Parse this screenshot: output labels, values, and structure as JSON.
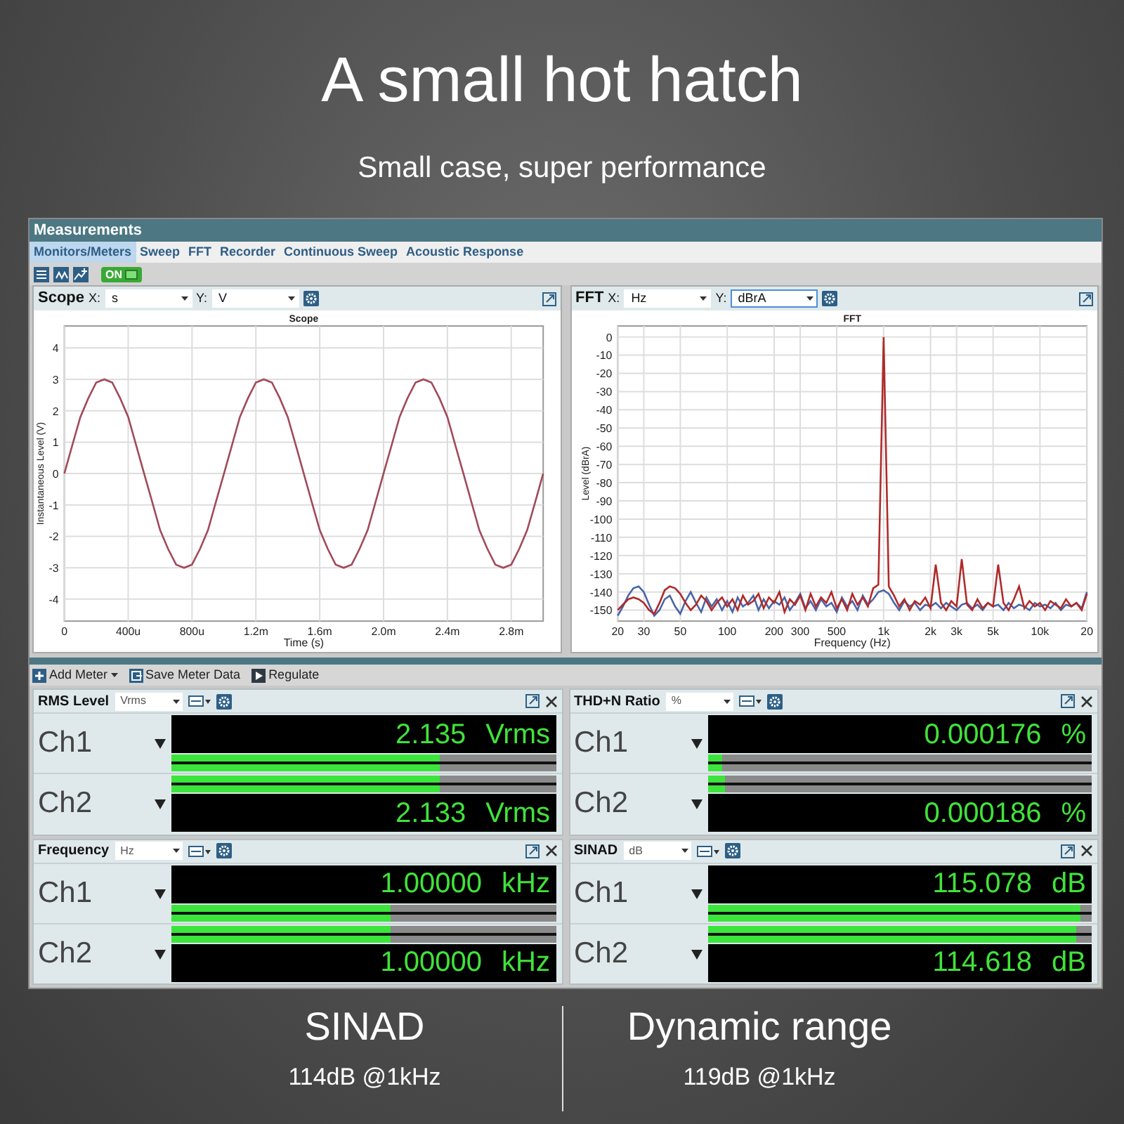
{
  "headline": "A small hot hatch",
  "subheadline": "Small case, super performance",
  "window": {
    "title": "Measurements",
    "tabs": [
      {
        "label": "Monitors/Meters",
        "selected": true
      },
      {
        "label": "Sweep",
        "selected": false
      },
      {
        "label": "FFT",
        "selected": false
      },
      {
        "label": "Recorder",
        "selected": false
      },
      {
        "label": "Continuous Sweep",
        "selected": false
      },
      {
        "label": "Acoustic Response",
        "selected": false
      }
    ],
    "toolbar": {
      "switch": {
        "label": "ON",
        "on": true
      }
    },
    "graphs": [
      {
        "title": "Scope",
        "x_label": "X:",
        "x_unit": "s",
        "y_label": "Y:",
        "y_unit": "V",
        "y_focused": false,
        "chart_data": {
          "type": "line",
          "title": "Scope",
          "xlabel": "Time (s)",
          "ylabel": "Instantaneous Level (V)",
          "grid": true,
          "categories": [
            "0",
            null,
            null,
            null,
            null,
            null,
            null,
            null,
            "400u",
            null,
            null,
            null,
            null,
            null,
            null,
            null,
            "800u",
            null,
            null,
            null,
            null,
            null,
            null,
            null,
            "1.2m",
            null,
            null,
            null,
            null,
            null,
            null,
            null,
            "1.6m",
            null,
            null,
            null,
            null,
            null,
            null,
            null,
            "2.0m",
            null,
            null,
            null,
            null,
            null,
            null,
            null,
            "2.4m",
            null,
            null,
            null,
            null,
            null,
            null,
            null,
            "2.8m",
            null,
            null,
            null,
            null
          ],
          "series": [
            {
              "color": "#a04a5a",
              "values": [
                0,
                0.9,
                1.8,
                2.4,
                2.9,
                3,
                2.9,
                2.4,
                1.8,
                0.9,
                0,
                -0.9,
                -1.8,
                -2.4,
                -2.9,
                -3,
                -2.9,
                -2.4,
                -1.8,
                -0.9,
                0,
                0.9,
                1.8,
                2.4,
                2.9,
                3,
                2.9,
                2.4,
                1.8,
                0.9,
                0,
                -0.9,
                -1.8,
                -2.4,
                -2.9,
                -3,
                -2.9,
                -2.4,
                -1.8,
                -0.9,
                0,
                0.9,
                1.8,
                2.4,
                2.9,
                3,
                2.9,
                2.4,
                1.8,
                0.9,
                0,
                -0.9,
                -1.8,
                -2.4,
                -2.9,
                -3,
                -2.9,
                -2.4,
                -1.8,
                -0.9,
                0
              ]
            }
          ],
          "ylim": [
            -4.7,
            4.7
          ],
          "yticks": [
            -4,
            -3,
            -2,
            -1,
            0,
            1,
            2,
            3,
            4
          ]
        }
      },
      {
        "title": "FFT",
        "x_label": "X:",
        "x_unit": "Hz",
        "y_label": "Y:",
        "y_unit": "dBrA",
        "y_focused": true,
        "chart_data": {
          "type": "line",
          "title": "FFT",
          "xlabel": "Frequency (Hz)",
          "ylabel": "Level (dBrA)",
          "grid": true,
          "categories": [
            "20",
            null,
            null,
            null,
            null,
            "30",
            null,
            null,
            null,
            null,
            null,
            null,
            "50",
            null,
            null,
            null,
            null,
            null,
            null,
            null,
            null,
            "100",
            null,
            null,
            null,
            null,
            null,
            null,
            null,
            null,
            "200",
            null,
            null,
            null,
            null,
            "300",
            null,
            null,
            null,
            null,
            null,
            null,
            "500",
            null,
            null,
            null,
            null,
            null,
            null,
            null,
            null,
            "1k",
            null,
            null,
            null,
            null,
            null,
            null,
            null,
            null,
            "2k",
            null,
            null,
            null,
            null,
            "3k",
            null,
            null,
            null,
            null,
            null,
            null,
            "5k",
            null,
            null,
            null,
            null,
            null,
            null,
            null,
            null,
            "10k",
            null,
            null,
            null,
            null,
            null,
            null,
            null,
            null,
            "20"
          ],
          "series": [
            {
              "color": "#4a64a8",
              "values": [
                -153,
                -148,
                -142,
                -138,
                -137,
                -140,
                -147,
                -153,
                -150,
                -144,
                -142,
                -148,
                -152,
                -145,
                -140,
                -146,
                -151,
                -143,
                -148,
                -144,
                -150,
                -145,
                -151,
                -143,
                -148,
                -146,
                -142,
                -150,
                -144,
                -149,
                -145,
                -147,
                -143,
                -150,
                -146,
                -141,
                -149,
                -145,
                -150,
                -144,
                -148,
                -146,
                -151,
                -143,
                -148,
                -145,
                -150,
                -142,
                -147,
                -144,
                -140,
                -139,
                -141,
                -146,
                -150,
                -145,
                -148,
                -146,
                -150,
                -147,
                -148,
                -146,
                -149,
                -146,
                -148,
                -150,
                -147,
                -146,
                -149,
                -147,
                -150,
                -146,
                -148,
                -147,
                -150,
                -146,
                -149,
                -147,
                -148,
                -150,
                -146,
                -148,
                -147,
                -149,
                -146,
                -150,
                -147,
                -148,
                -146,
                -149,
                -140
              ]
            },
            {
              "color": "#b02a2a",
              "values": [
                -150,
                -147,
                -144,
                -143,
                -144,
                -146,
                -150,
                -152,
                -146,
                -139,
                -137,
                -138,
                -141,
                -146,
                -150,
                -147,
                -142,
                -145,
                -150,
                -146,
                -143,
                -148,
                -144,
                -150,
                -142,
                -147,
                -145,
                -141,
                -149,
                -143,
                -146,
                -140,
                -151,
                -144,
                -147,
                -142,
                -150,
                -141,
                -148,
                -143,
                -146,
                -140,
                -149,
                -144,
                -150,
                -141,
                -147,
                -143,
                -148,
                -138,
                -136,
                0,
                -137,
                -142,
                -148,
                -144,
                -150,
                -145,
                -147,
                -143,
                -149,
                -125,
                -146,
                -150,
                -145,
                -148,
                -122,
                -147,
                -150,
                -144,
                -149,
                -146,
                -148,
                -125,
                -146,
                -150,
                -144,
                -137,
                -149,
                -145,
                -148,
                -146,
                -150,
                -145,
                -147,
                -149,
                -144,
                -148,
                -146,
                -150,
                -141
              ]
            }
          ],
          "ylim": [
            -156,
            6
          ],
          "yticks": [
            0,
            -10,
            -20,
            -30,
            -40,
            -50,
            -60,
            -70,
            -80,
            -90,
            -100,
            -110,
            -120,
            -130,
            -140,
            -150
          ]
        }
      }
    ],
    "meter_toolbar": [
      {
        "label": "Add Meter",
        "kind": "dropdown"
      },
      {
        "label": "Save Meter Data",
        "kind": "button"
      },
      {
        "label": "Regulate",
        "kind": "button"
      }
    ],
    "meters": [
      {
        "title": "RMS Level",
        "unit": "Vrms",
        "channels": [
          {
            "label": "Ch1",
            "value": "2.135",
            "unit": "Vrms",
            "level": 0.7
          },
          {
            "label": "Ch2",
            "value": "2.133",
            "unit": "Vrms",
            "level": 0.7
          }
        ]
      },
      {
        "title": "THD+N Ratio",
        "unit": "%",
        "channels": [
          {
            "label": "Ch1",
            "value": "0.000176",
            "unit": "%",
            "level": 0.04
          },
          {
            "label": "Ch2",
            "value": "0.000186",
            "unit": "%",
            "level": 0.045
          }
        ]
      },
      {
        "title": "Frequency",
        "unit": "Hz",
        "channels": [
          {
            "label": "Ch1",
            "value": "1.00000",
            "unit": "kHz",
            "level": 0.57
          },
          {
            "label": "Ch2",
            "value": "1.00000",
            "unit": "kHz",
            "level": 0.57
          }
        ]
      },
      {
        "title": "SINAD",
        "unit": "dB",
        "channels": [
          {
            "label": "Ch1",
            "value": "115.078",
            "unit": "dB",
            "level": 0.97
          },
          {
            "label": "Ch2",
            "value": "114.618",
            "unit": "dB",
            "level": 0.96
          }
        ]
      }
    ]
  },
  "specs": [
    {
      "title": "SINAD",
      "detail": "114dB @1kHz"
    },
    {
      "title": "Dynamic range",
      "detail": "119dB @1kHz"
    }
  ]
}
